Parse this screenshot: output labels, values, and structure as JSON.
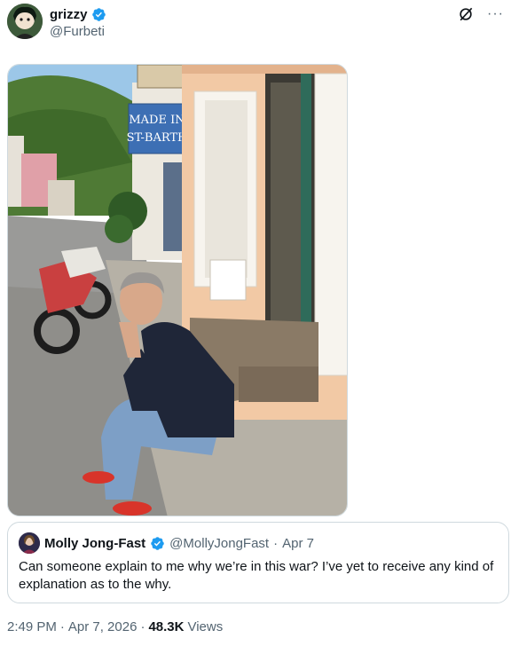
{
  "tweet": {
    "display_name": "grizzy",
    "handle": "@Furbeti",
    "more_glyph": "···",
    "photo": {
      "sign_text_line1": "MADE IN",
      "sign_text_line2": "ST-BARTH"
    },
    "timestamp": "2:49 PM",
    "separator": "·",
    "date": "Apr 7, 2026",
    "views_count": "48.3K",
    "views_label": "Views"
  },
  "quoted": {
    "display_name": "Molly Jong-Fast",
    "handle": "@MollyJongFast",
    "separator": "·",
    "date": "Apr 7",
    "text": "Can someone explain to me why we’re in this war? I’ve yet to receive any kind of explanation as to the why."
  },
  "colors": {
    "verified_blue": "#1d9bf0",
    "secondary_text": "#536471",
    "border": "#cfd9de"
  },
  "icons": {
    "verified": "verified-badge-icon",
    "grok": "grok-icon",
    "more": "more-icon"
  }
}
